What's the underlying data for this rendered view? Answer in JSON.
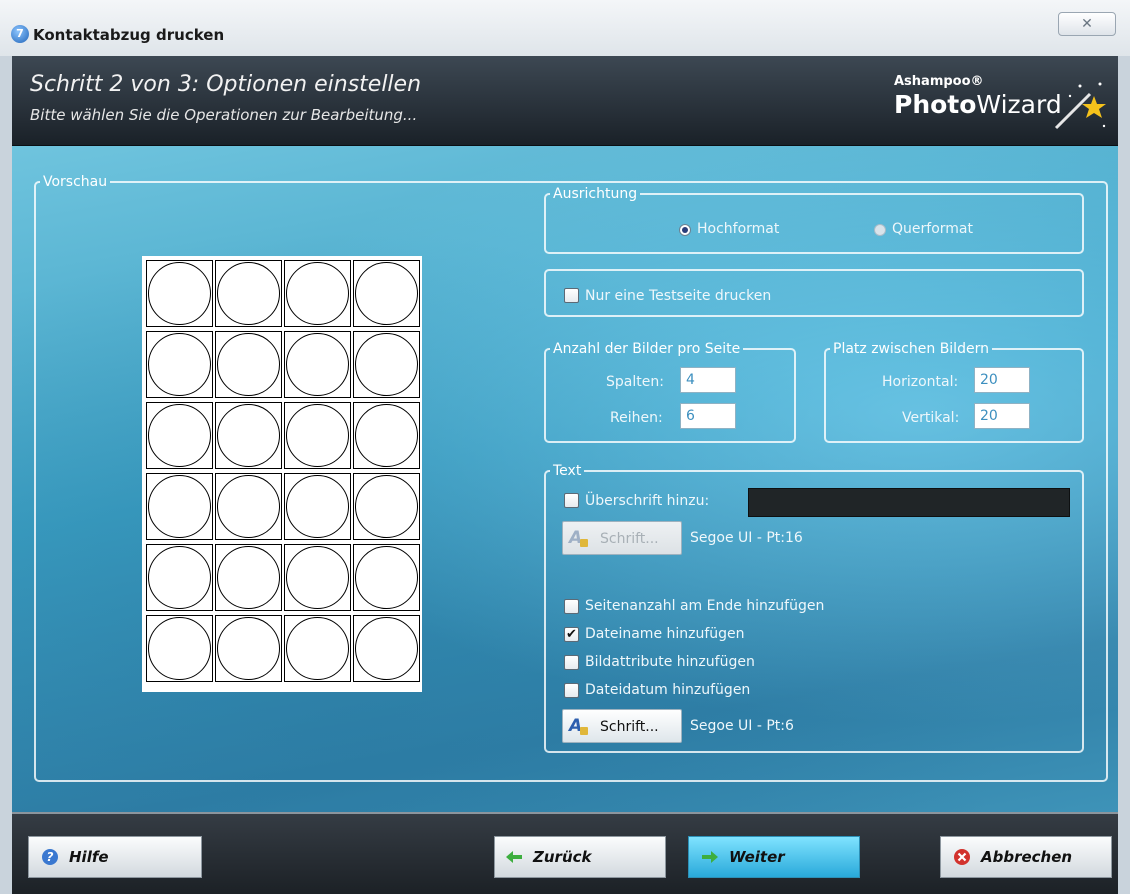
{
  "window": {
    "title": "Kontaktabzug drucken",
    "icon_text": "7",
    "close_glyph": "✕"
  },
  "header": {
    "step_title": "Schritt 2 von 3: Optionen einstellen",
    "step_subtitle": "Bitte wählen Sie die Operationen zur Bearbeitung...",
    "brand_small": "Ashampoo®",
    "brand_photo": "Photo",
    "brand_wizard": "Wizard"
  },
  "preview": {
    "legend": "Vorschau",
    "columns": 4,
    "rows": 6
  },
  "orientation": {
    "legend": "Ausrichtung",
    "options": [
      "Hochformat",
      "Querformat"
    ],
    "selected": "Hochformat"
  },
  "testpage": {
    "label": "Nur eine Testseite drucken",
    "checked": false
  },
  "images_per_page": {
    "legend": "Anzahl der Bilder pro Seite",
    "columns_label": "Spalten:",
    "columns_value": "4",
    "rows_label": "Reihen:",
    "rows_value": "6"
  },
  "spacing": {
    "legend": "Platz zwischen Bildern",
    "horizontal_label": "Horizontal:",
    "horizontal_value": "20",
    "vertical_label": "Vertikal:",
    "vertical_value": "20"
  },
  "text_section": {
    "legend": "Text",
    "heading_label": "Überschrift hinzu:",
    "heading_checked": false,
    "heading_value": "",
    "heading_font_button": "Schrift...",
    "heading_font_info": "Segoe UI - Pt:16",
    "options": [
      {
        "label": "Seitenanzahl am Ende hinzufügen",
        "checked": false
      },
      {
        "label": "Dateiname hinzufügen",
        "checked": true
      },
      {
        "label": "Bildattribute hinzufügen",
        "checked": false
      },
      {
        "label": "Dateidatum hinzufügen",
        "checked": false
      }
    ],
    "font_button": "Schrift...",
    "font_info": "Segoe UI - Pt:6"
  },
  "footer": {
    "help": "Hilfe",
    "back": "Zurück",
    "next": "Weiter",
    "cancel": "Abbrechen"
  },
  "colors": {
    "accent": "#29a9da",
    "header_bg": "#2a333c",
    "footer_bg": "#282e34"
  }
}
